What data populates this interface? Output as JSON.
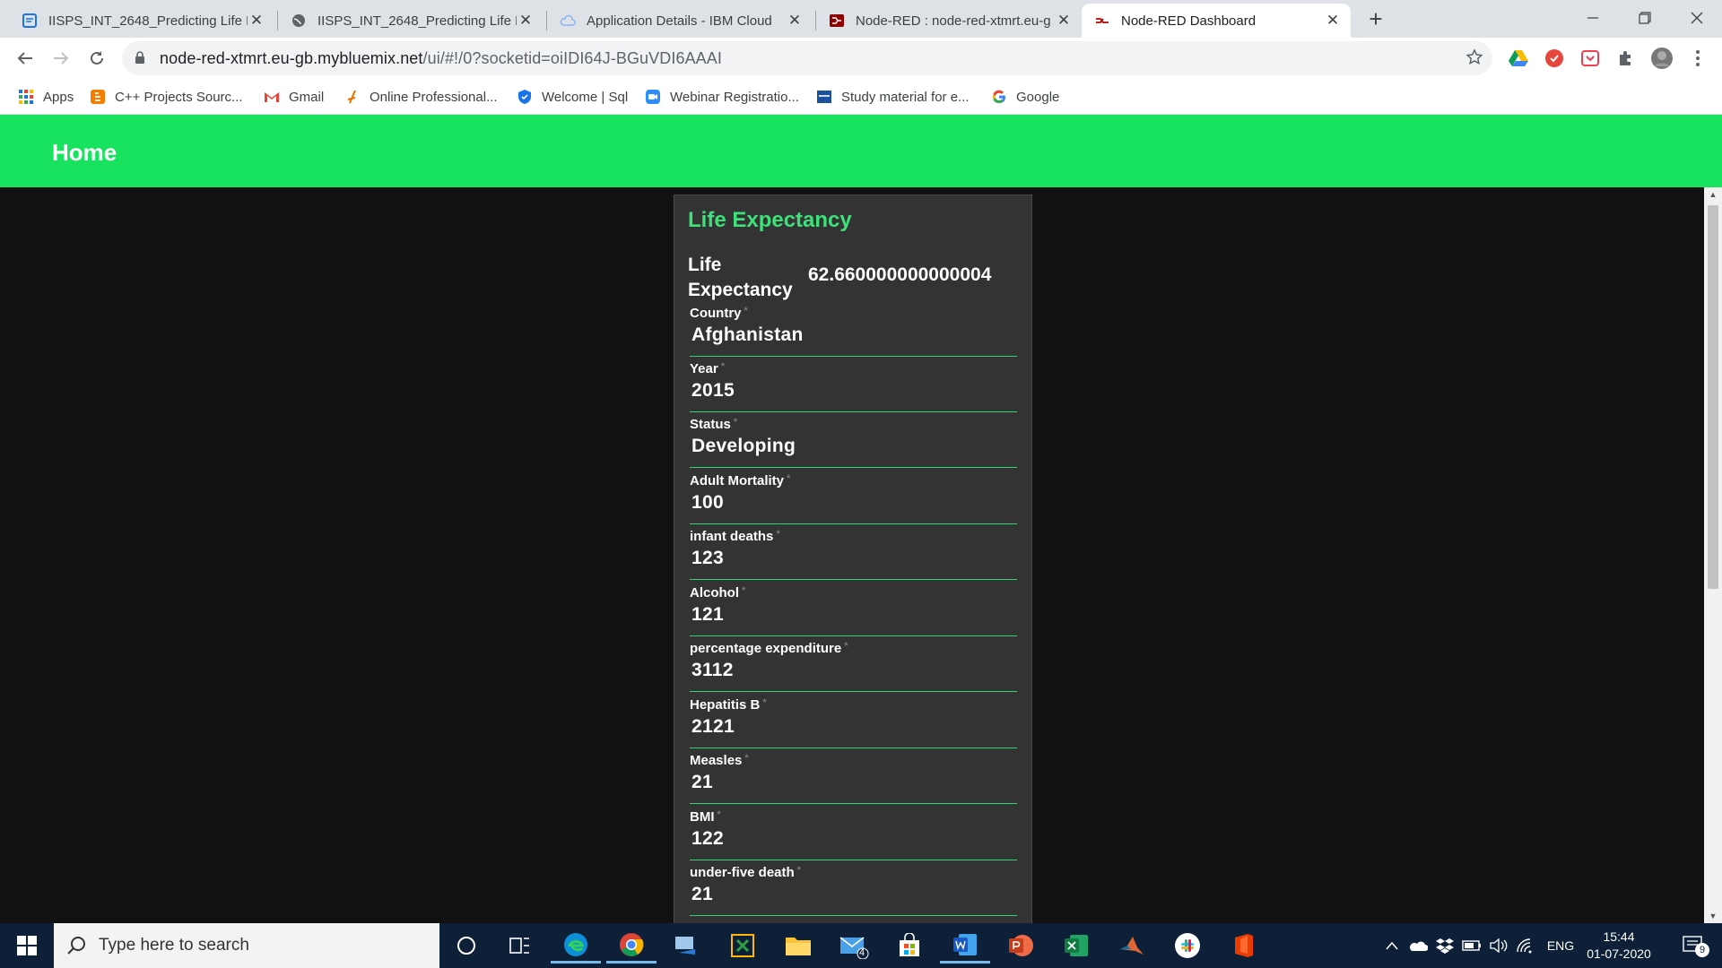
{
  "browser": {
    "tabs": [
      {
        "title": "IISPS_INT_2648_Predicting Life Ex",
        "icon": "docs-icon"
      },
      {
        "title": "IISPS_INT_2648_Predicting Life Ex",
        "icon": "globe-icon"
      },
      {
        "title": "Application Details - IBM Cloud",
        "icon": "cloud-icon"
      },
      {
        "title": "Node-RED : node-red-xtmrt.eu-g",
        "icon": "node-red-icon"
      },
      {
        "title": "Node-RED Dashboard",
        "icon": "node-red-icon",
        "active": true
      }
    ],
    "url_host": "node-red-xtmrt.eu-gb.mybluemix.net",
    "url_path": "/ui/#!/0?socketid=oiIDI64J-BGuVDI6AAAI",
    "bookmarks": [
      {
        "label": "Apps",
        "icon": "apps-grid-icon"
      },
      {
        "label": "C++ Projects Sourc...",
        "icon": "blogger-icon"
      },
      {
        "label": "Gmail",
        "icon": "gmail-icon"
      },
      {
        "label": "Online Professional...",
        "icon": "course-icon"
      },
      {
        "label": "Welcome | Sql",
        "icon": "shield-icon"
      },
      {
        "label": "Webinar Registratio...",
        "icon": "zoom-icon"
      },
      {
        "label": "Study material for e...",
        "icon": "study-icon"
      },
      {
        "label": "Google",
        "icon": "google-icon"
      }
    ]
  },
  "dashboard": {
    "header_title": "Home",
    "card_title": "Life Expectancy",
    "result_label": "Life Expectancy",
    "result_value": "62.660000000000004",
    "fields": [
      {
        "label": "Country",
        "value": "Afghanistan"
      },
      {
        "label": "Year",
        "value": "2015"
      },
      {
        "label": "Status",
        "value": "Developing"
      },
      {
        "label": "Adult Mortality",
        "value": "100"
      },
      {
        "label": "infant deaths",
        "value": "123"
      },
      {
        "label": "Alcohol",
        "value": "121"
      },
      {
        "label": "percentage expenditure",
        "value": "3112"
      },
      {
        "label": "Hepatitis B",
        "value": "2121"
      },
      {
        "label": "Measles",
        "value": "21"
      },
      {
        "label": "BMI",
        "value": "122"
      },
      {
        "label": "under-five death",
        "value": "21"
      }
    ],
    "required_marker": "*",
    "colors": {
      "header": "#17e35e",
      "accent": "#3ee07a",
      "card": "#333333",
      "background": "#111111"
    }
  },
  "taskbar": {
    "search_placeholder": "Type here to search",
    "mail_badge": "4",
    "language": "ENG",
    "time": "15:44",
    "date": "01-07-2020",
    "notification_count": "9"
  }
}
